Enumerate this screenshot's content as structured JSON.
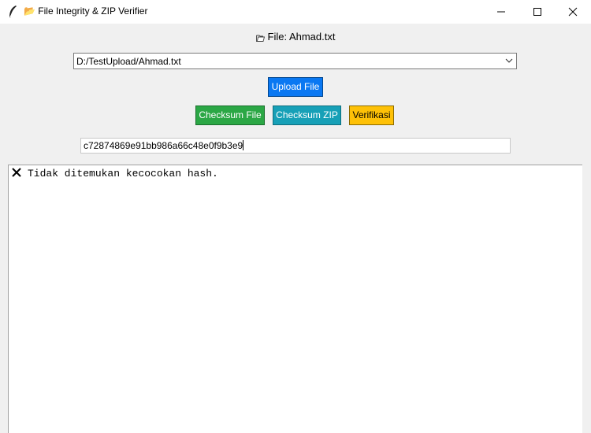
{
  "window": {
    "title": "📂 File Integrity & ZIP Verifier",
    "controls": [
      "minimize",
      "maximize",
      "close"
    ]
  },
  "file_label": "File: Ahmad.txt",
  "file_path_select": {
    "value": "D:/TestUpload/Ahmad.txt"
  },
  "buttons": {
    "upload": "Upload File",
    "checksum_file": "Checksum File",
    "checksum_zip": "Checksum ZIP",
    "verify": "Verifikasi"
  },
  "hash_input": {
    "value": "c72874869e91bb986a66c48e0f9b3e9"
  },
  "output": {
    "line": "Tidak ditemukan kecocokan hash."
  },
  "icons": {
    "app": "feather-icon",
    "folder": "folder-icon",
    "result": "x-icon"
  },
  "colors": {
    "upload": "#0a78f2",
    "checksum_file": "#2ba745",
    "checksum_zip": "#17a0b7",
    "verify": "#fec107"
  }
}
